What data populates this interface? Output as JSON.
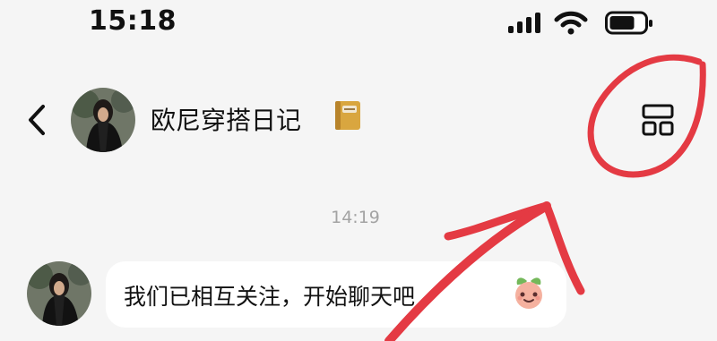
{
  "status_bar": {
    "time": "15:18",
    "icons": [
      "signal-icon",
      "wifi-icon",
      "battery-icon"
    ]
  },
  "header": {
    "back_icon": "chevron-left-icon",
    "title": "欧尼穿搭日记",
    "title_emoji": "notebook-icon",
    "action_icon": "layout-grid-icon"
  },
  "conversation": {
    "timestamp": "14:19",
    "messages": [
      {
        "text": "我们已相互关注，开始聊天吧",
        "emoji": "peach-face-icon"
      }
    ]
  },
  "colors": {
    "background": "#f5f5f5",
    "bubble": "#ffffff",
    "timestamp": "#a3a3a3",
    "annotation": "#e43a43"
  }
}
